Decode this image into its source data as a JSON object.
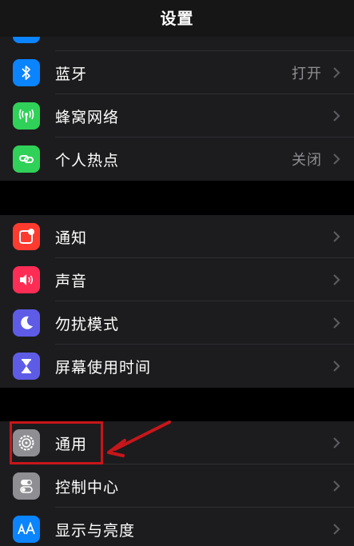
{
  "nav": {
    "title": "设置"
  },
  "groups": [
    {
      "items": [
        {
          "label": "",
          "value": "",
          "icon": "wifi-icon",
          "color": "#0a84ff"
        },
        {
          "label": "蓝牙",
          "value": "打开",
          "icon": "bluetooth-icon",
          "color": "#0a84ff"
        },
        {
          "label": "蜂窝网络",
          "value": "",
          "icon": "antenna-icon",
          "color": "#30d158"
        },
        {
          "label": "个人热点",
          "value": "关闭",
          "icon": "hotspot-icon",
          "color": "#30d158"
        }
      ]
    },
    {
      "items": [
        {
          "label": "通知",
          "value": "",
          "icon": "notifications-icon",
          "color": "#ff3b30"
        },
        {
          "label": "声音",
          "value": "",
          "icon": "speaker-icon",
          "color": "#ff2d55"
        },
        {
          "label": "勿扰模式",
          "value": "",
          "icon": "moon-icon",
          "color": "#5e5ce6"
        },
        {
          "label": "屏幕使用时间",
          "value": "",
          "icon": "hourglass-icon",
          "color": "#5e5ce6"
        }
      ]
    },
    {
      "items": [
        {
          "label": "通用",
          "value": "",
          "icon": "gear-icon",
          "color": "#8e8e93"
        },
        {
          "label": "控制中心",
          "value": "",
          "icon": "toggles-icon",
          "color": "#8e8e93"
        },
        {
          "label": "显示与亮度",
          "value": "",
          "icon": "text-size-icon",
          "color": "#0a84ff"
        }
      ]
    }
  ],
  "annotation": {
    "color": "#c7161b"
  }
}
